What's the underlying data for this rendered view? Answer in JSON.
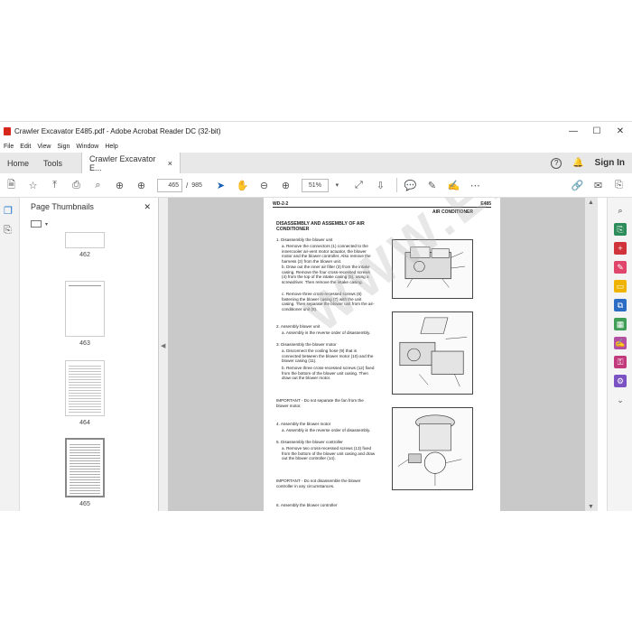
{
  "window": {
    "title": "Crawler Excavator E485.pdf - Adobe Acrobat Reader DC (32-bit)",
    "controls": [
      "—",
      "☐",
      "✕"
    ]
  },
  "menu": [
    "File",
    "Edit",
    "View",
    "Sign",
    "Window",
    "Help"
  ],
  "tabs": {
    "home": "Home",
    "tools": "Tools",
    "doc": "Crawler Excavator E...",
    "doc_close": "×",
    "sign_in": "Sign In"
  },
  "toolbar": {
    "page_current": "465",
    "page_sep": "/",
    "page_total": "985",
    "zoom": "51%"
  },
  "panel": {
    "title": "Page Thumbnails",
    "close": "✕",
    "thumbs": [
      {
        "label": "462"
      },
      {
        "label": "463"
      },
      {
        "label": "464"
      },
      {
        "label": "465"
      }
    ]
  },
  "page": {
    "header_left": "WD-2-2",
    "header_right": "E485",
    "section": "AIR CONDITIONER",
    "title": "DISASSEMBLY AND ASSEMBLY OF AIR CONDITIONER",
    "blocks": [
      "1. Disassembly the blower unit",
      "a. Remove the connectors (1) connected to the innercooler air-vent motor actuator, the blower motor and the blower controller. Also remove the harness (2) from the blower unit.",
      "b. Draw out the inner air filter (3) from the intake casing. Remove the four cross-recessed screws (4) from the top of the intake casing (5), using a screwdriver. Then remove the intake casing.",
      "c. Remove three cross-recessed screws (6) fastening the blower casing (7) with the unit casing. Then separate the blower unit from the air-conditioner unit (8).",
      "2. Assembly blower unit",
      "a. Assembly is the reverse order of disassembly.",
      "3. Disassembly the blower motor",
      "a. Disconnect the cooling hose (9) that is connected between the blower motor (10) and the blower casing (11).",
      "b. Remove three cross-recessed screws (12) fixed from the bottom of the blower unit casing. Then draw out the blower motor.",
      "IMPORTANT - Do not separate the fan from the blower motor.",
      "4. Assembly the blower motor",
      "a. Assembly is the reverse order of disassembly.",
      "5. Disassembly the blower controller",
      "a. Remove two cross-recessed screws (13) fixed from the bottom of the blower unit casing and draw out the blower controller (14).",
      "IMPORTANT - Do not disassemble the blower controller in any circumstances.",
      "6. Assembly the blower controller"
    ],
    "watermark": "WWW.EPCATALOG.COM"
  }
}
